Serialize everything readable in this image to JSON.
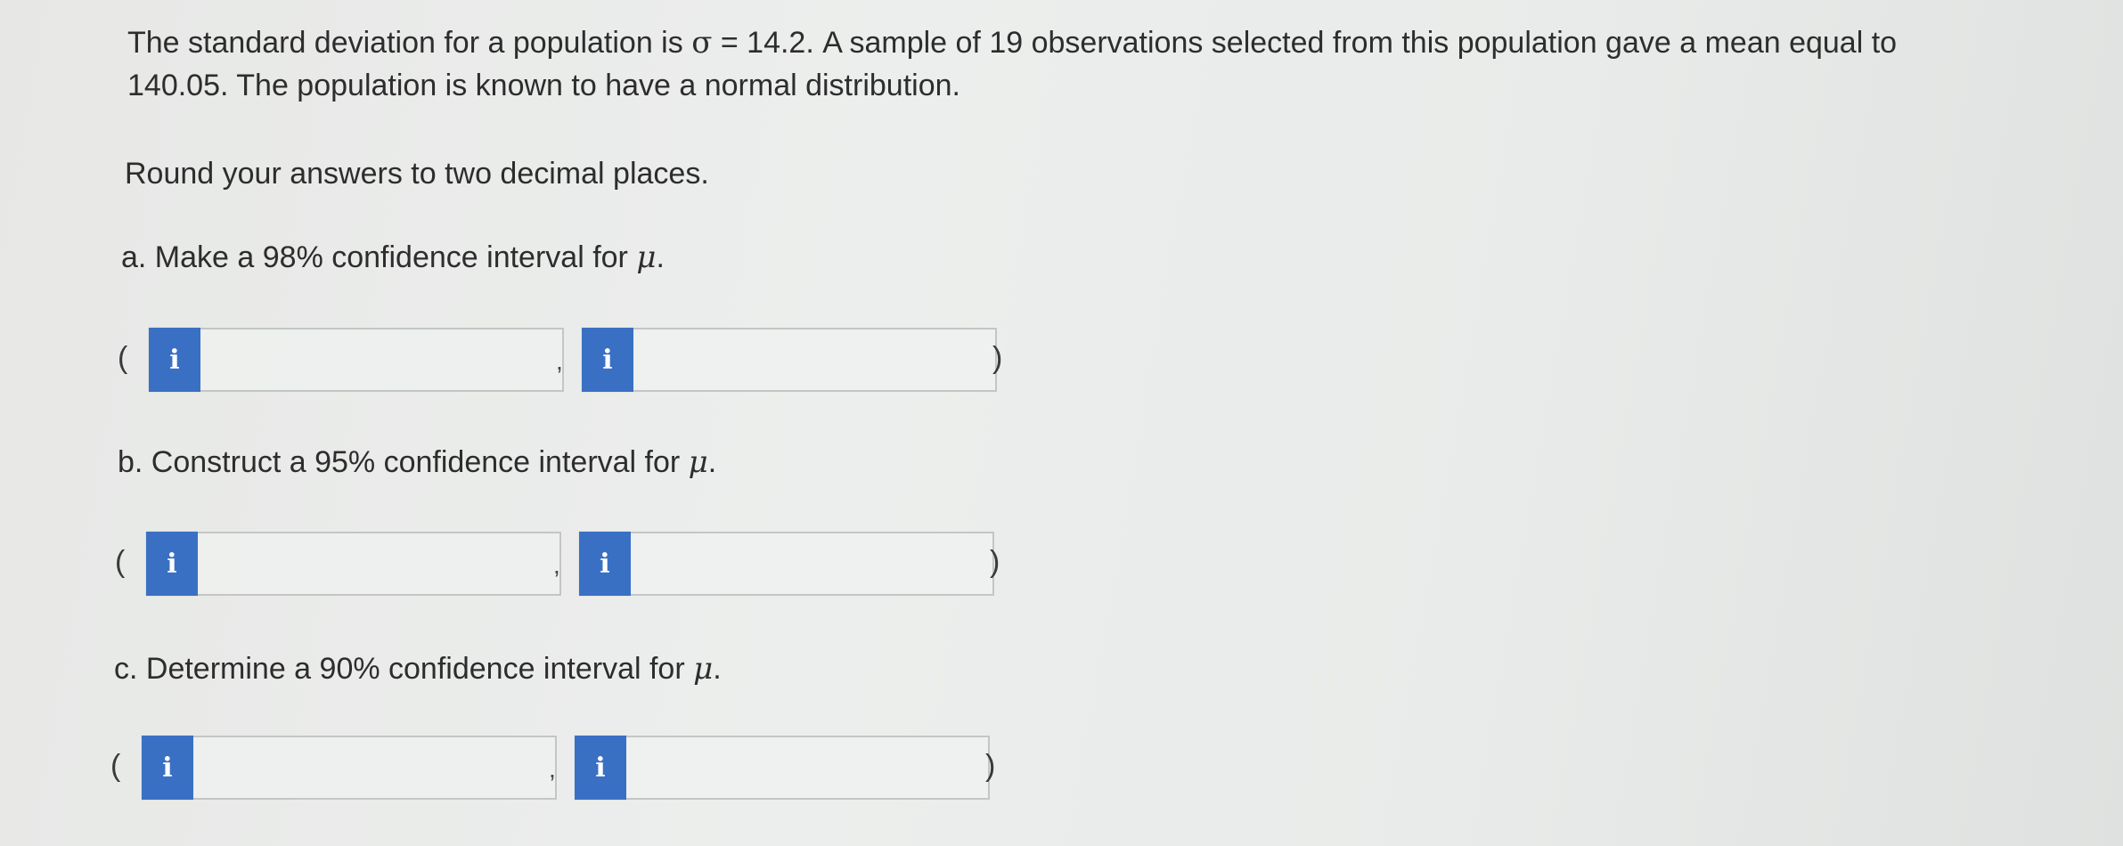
{
  "problem": {
    "intro_before_sigma": "The standard deviation for a population is ",
    "sigma_symbol": "σ",
    "intro_after_sigma": " = 14.2. A sample of 19 observations selected from this population gave a mean equal to 140.05. The population is known to have a normal distribution.",
    "rounding": "Round your answers to two decimal places."
  },
  "parts": [
    {
      "question": "a. Make a 98% confidence interval for ",
      "mu": "μ",
      "period": ".",
      "lower_value": "",
      "upper_value": ""
    },
    {
      "question": "b. Construct a 95% confidence interval for ",
      "mu": "μ",
      "period": ".",
      "lower_value": "",
      "upper_value": ""
    },
    {
      "question": "c. Determine a 90% confidence interval for ",
      "mu": "μ",
      "period": ".",
      "lower_value": "",
      "upper_value": ""
    }
  ],
  "symbols": {
    "open_paren": "(",
    "close_paren": ")",
    "comma": ",",
    "info_label": "i"
  },
  "icons": {
    "info_button_icon": "info-i-icon",
    "info_button_color": "#3a70c4"
  }
}
